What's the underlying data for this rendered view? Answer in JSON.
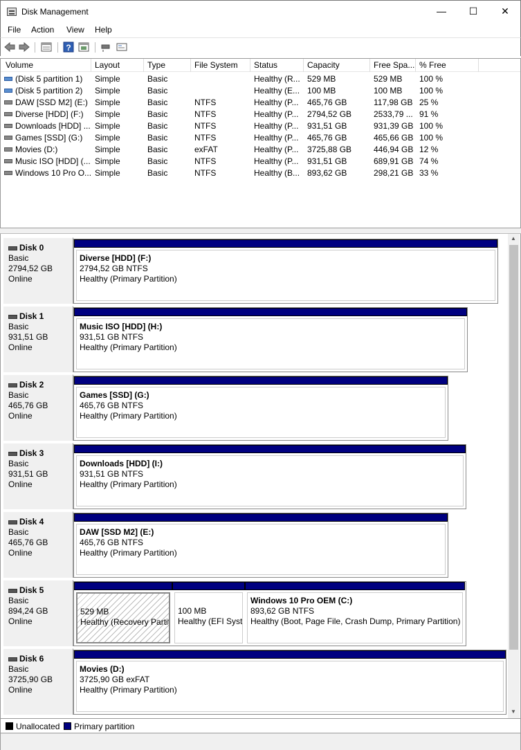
{
  "window": {
    "title": "Disk Management",
    "minimize": "—",
    "maximize": "☐",
    "close": "✕"
  },
  "menu": [
    "File",
    "Action",
    "View",
    "Help"
  ],
  "toolbar_icons": [
    "back-arrow-icon",
    "forward-arrow-icon",
    "properties-icon",
    "help-icon",
    "refresh-icon",
    "rescan-icon",
    "settings-icon"
  ],
  "table": {
    "columns": [
      "Volume",
      "Layout",
      "Type",
      "File System",
      "Status",
      "Capacity",
      "Free Spa...",
      "% Free"
    ],
    "rows": [
      [
        "(Disk 5 partition 1)",
        "Simple",
        "Basic",
        "",
        "Healthy (R...",
        "529 MB",
        "529 MB",
        "100 %"
      ],
      [
        "(Disk 5 partition 2)",
        "Simple",
        "Basic",
        "",
        "Healthy (E...",
        "100 MB",
        "100 MB",
        "100 %"
      ],
      [
        "DAW [SSD M2] (E:)",
        "Simple",
        "Basic",
        "NTFS",
        "Healthy (P...",
        "465,76 GB",
        "117,98 GB",
        "25 %"
      ],
      [
        "Diverse [HDD] (F:)",
        "Simple",
        "Basic",
        "NTFS",
        "Healthy (P...",
        "2794,52 GB",
        "2533,79 ...",
        "91 %"
      ],
      [
        "Downloads [HDD] ...",
        "Simple",
        "Basic",
        "NTFS",
        "Healthy (P...",
        "931,51 GB",
        "931,39 GB",
        "100 %"
      ],
      [
        "Games [SSD] (G:)",
        "Simple",
        "Basic",
        "NTFS",
        "Healthy (P...",
        "465,76 GB",
        "465,66 GB",
        "100 %"
      ],
      [
        "Movies (D:)",
        "Simple",
        "Basic",
        "exFAT",
        "Healthy (P...",
        "3725,88 GB",
        "446,94 GB",
        "12 %"
      ],
      [
        "Music ISO [HDD] (...",
        "Simple",
        "Basic",
        "NTFS",
        "Healthy (P...",
        "931,51 GB",
        "689,91 GB",
        "74 %"
      ],
      [
        "Windows 10 Pro O...",
        "Simple",
        "Basic",
        "NTFS",
        "Healthy (B...",
        "893,62 GB",
        "298,21 GB",
        "33 %"
      ]
    ]
  },
  "disks": [
    {
      "name": "Disk 0",
      "type": "Basic",
      "size": "2794,52 GB",
      "status": "Online",
      "partitions": [
        {
          "name": "Diverse [HDD]  (F:)",
          "size": "2794,52 GB NTFS",
          "status": "Healthy (Primary Partition)"
        }
      ]
    },
    {
      "name": "Disk 1",
      "type": "Basic",
      "size": "931,51 GB",
      "status": "Online",
      "partitions": [
        {
          "name": "Music ISO [HDD]  (H:)",
          "size": "931,51 GB NTFS",
          "status": "Healthy (Primary Partition)"
        }
      ]
    },
    {
      "name": "Disk 2",
      "type": "Basic",
      "size": "465,76 GB",
      "status": "Online",
      "partitions": [
        {
          "name": "Games [SSD]  (G:)",
          "size": "465,76 GB NTFS",
          "status": "Healthy (Primary Partition)"
        }
      ]
    },
    {
      "name": "Disk 3",
      "type": "Basic",
      "size": "931,51 GB",
      "status": "Online",
      "partitions": [
        {
          "name": "Downloads [HDD]  (I:)",
          "size": "931,51 GB NTFS",
          "status": "Healthy (Primary Partition)"
        }
      ]
    },
    {
      "name": "Disk 4",
      "type": "Basic",
      "size": "465,76 GB",
      "status": "Online",
      "partitions": [
        {
          "name": "DAW [SSD M2]  (E:)",
          "size": "465,76 GB NTFS",
          "status": "Healthy (Primary Partition)"
        }
      ]
    },
    {
      "name": "Disk 5",
      "type": "Basic",
      "size": "894,24 GB",
      "status": "Online",
      "partitions": [
        {
          "name": "",
          "size": "529 MB",
          "status": "Healthy (Recovery Partit"
        },
        {
          "name": "",
          "size": "100 MB",
          "status": "Healthy (EFI Syste"
        },
        {
          "name": "Windows 10 Pro OEM  (C:)",
          "size": "893,62 GB NTFS",
          "status": "Healthy (Boot, Page File, Crash Dump, Primary Partition)"
        }
      ]
    },
    {
      "name": "Disk 6",
      "type": "Basic",
      "size": "3725,90 GB",
      "status": "Online",
      "partitions": [
        {
          "name": "Movies  (D:)",
          "size": "3725,90 GB exFAT",
          "status": "Healthy (Primary Partition)"
        }
      ]
    }
  ],
  "legend": {
    "unallocated": "Unallocated",
    "primary": "Primary partition",
    "unallocated_color": "#000000",
    "primary_color": "#000080"
  }
}
